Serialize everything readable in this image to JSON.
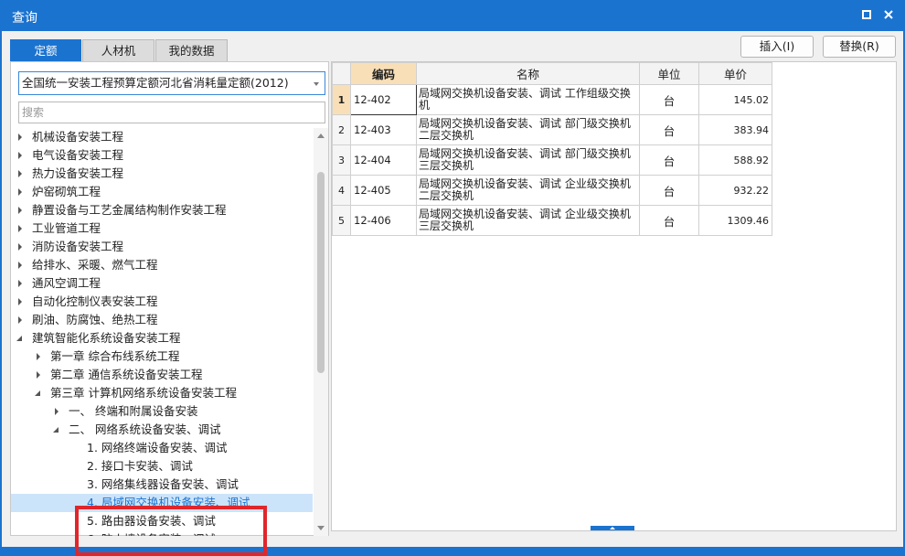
{
  "window": {
    "title": "查询"
  },
  "tabs": [
    {
      "label": "定额",
      "active": true
    },
    {
      "label": "人材机",
      "active": false
    },
    {
      "label": "我的数据",
      "active": false
    }
  ],
  "toolbar": {
    "insert_label": "插入(I)",
    "replace_label": "替换(R)"
  },
  "left": {
    "library_select": "全国统一安装工程预算定额河北省消耗量定额(2012)",
    "search_placeholder": "搜索",
    "tree": [
      {
        "label": "机械设备安装工程",
        "level": 0,
        "state": "collapsed"
      },
      {
        "label": "电气设备安装工程",
        "level": 0,
        "state": "collapsed"
      },
      {
        "label": "热力设备安装工程",
        "level": 0,
        "state": "collapsed"
      },
      {
        "label": "炉窑砌筑工程",
        "level": 0,
        "state": "collapsed"
      },
      {
        "label": "静置设备与工艺金属结构制作安装工程",
        "level": 0,
        "state": "collapsed"
      },
      {
        "label": "工业管道工程",
        "level": 0,
        "state": "collapsed"
      },
      {
        "label": "消防设备安装工程",
        "level": 0,
        "state": "collapsed"
      },
      {
        "label": "给排水、采暖、燃气工程",
        "level": 0,
        "state": "collapsed"
      },
      {
        "label": "通风空调工程",
        "level": 0,
        "state": "collapsed"
      },
      {
        "label": "自动化控制仪表安装工程",
        "level": 0,
        "state": "collapsed"
      },
      {
        "label": "刷油、防腐蚀、绝热工程",
        "level": 0,
        "state": "collapsed"
      },
      {
        "label": "建筑智能化系统设备安装工程",
        "level": 0,
        "state": "expanded"
      },
      {
        "label": "第一章 综合布线系统工程",
        "level": 1,
        "state": "collapsed"
      },
      {
        "label": "第二章 通信系统设备安装工程",
        "level": 1,
        "state": "collapsed"
      },
      {
        "label": "第三章 计算机网络系统设备安装工程",
        "level": 1,
        "state": "expanded"
      },
      {
        "label": "一、 终端和附属设备安装",
        "level": 2,
        "state": "collapsed"
      },
      {
        "label": "二、 网络系统设备安装、调试",
        "level": 2,
        "state": "expanded"
      },
      {
        "label": "1. 网络终端设备安装、调试",
        "level": 3,
        "state": "leaf"
      },
      {
        "label": "2. 接口卡安装、调试",
        "level": 3,
        "state": "leaf"
      },
      {
        "label": "3. 网络集线器设备安装、调试",
        "level": 3,
        "state": "leaf"
      },
      {
        "label": "4. 局域网交换机设备安装、调试",
        "level": 3,
        "state": "leaf",
        "selected": true
      },
      {
        "label": "5. 路由器设备安装、调试",
        "level": 3,
        "state": "leaf"
      },
      {
        "label": "6. 防火墙设备安装、调试",
        "level": 3,
        "state": "leaf"
      }
    ]
  },
  "table": {
    "headers": [
      "编码",
      "名称",
      "单位",
      "单价"
    ],
    "rows": [
      {
        "index": "1",
        "code": "12-402",
        "name": "局域网交换机设备安装、调试 工作组级交换机",
        "unit": "台",
        "price": "145.02"
      },
      {
        "index": "2",
        "code": "12-403",
        "name": "局域网交换机设备安装、调试 部门级交换机二层交换机",
        "unit": "台",
        "price": "383.94"
      },
      {
        "index": "3",
        "code": "12-404",
        "name": "局域网交换机设备安装、调试 部门级交换机三层交换机",
        "unit": "台",
        "price": "588.92"
      },
      {
        "index": "4",
        "code": "12-405",
        "name": "局域网交换机设备安装、调试 企业级交换机二层交换机",
        "unit": "台",
        "price": "932.22"
      },
      {
        "index": "5",
        "code": "12-406",
        "name": "局域网交换机设备安装、调试 企业级交换机三层交换机",
        "unit": "台",
        "price": "1309.46"
      }
    ]
  },
  "colors": {
    "accent": "#1b73d0",
    "header_highlight": "#f9dfb8",
    "selection": "#cce4fa",
    "annotation": "#e0262b"
  }
}
